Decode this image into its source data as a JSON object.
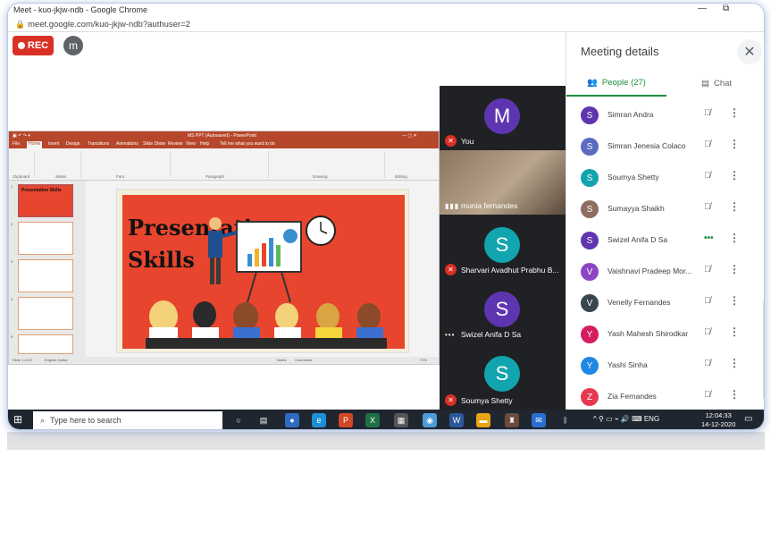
{
  "browser": {
    "title": "Meet - kuo-jkjw-ndb - Google Chrome",
    "url": "meet.google.com/kuo-jkjw-ndb?authuser=2"
  },
  "meet": {
    "rec_label": "REC",
    "self_initial": "m"
  },
  "presentation": {
    "window_title": "MS PPT (Autosaved) - PowerPoint",
    "tabs": [
      "File",
      "Home",
      "Insert",
      "Design",
      "Transitions",
      "Animations",
      "Slide Show",
      "Review",
      "View",
      "Help",
      "Tell me what you want to do"
    ],
    "ribbon_groups": [
      "Clipboard",
      "Slides",
      "Font",
      "Paragraph",
      "Drawing",
      "Editing"
    ],
    "slide_title_line1": "Presentation",
    "slide_title_line2": "Skills",
    "status_left": "Slide 1 of 22",
    "status_lang": "English (India)",
    "status_notes": "Notes",
    "status_comments": "Comments",
    "zoom": "72%",
    "thumb_numbers": [
      "1",
      "2",
      "3",
      "4",
      "5"
    ],
    "thumb_titles": [
      "Presentation Skills",
      "",
      "",
      "",
      ""
    ]
  },
  "tiles": [
    {
      "name": "You",
      "initial": "M",
      "color": "#5e35b1",
      "mic": "muted"
    },
    {
      "name": "munia fernandes",
      "initial": "",
      "color": "#7a6a58",
      "mic": "speaking"
    },
    {
      "name": "Sharvari Avadhut Prabhu B...",
      "initial": "S",
      "color": "#12a4af",
      "mic": "muted"
    },
    {
      "name": "Swizel Anifa D Sa",
      "initial": "S",
      "color": "#5e35b1",
      "mic": "dots"
    },
    {
      "name": "Soumya Shetty",
      "initial": "S",
      "color": "#12a4af",
      "mic": "muted"
    }
  ],
  "panel": {
    "title": "Meeting details",
    "tab_people": "People (27)",
    "tab_chat": "Chat",
    "people": [
      {
        "initial": "S",
        "name": "Simran Andra",
        "color": "#5e35b1",
        "status": "muted"
      },
      {
        "initial": "S",
        "name": "Simran Jenesia Colaco",
        "color": "#5c6bc0",
        "status": "muted"
      },
      {
        "initial": "S",
        "name": "Soumya Shetty",
        "color": "#12a4af",
        "status": "muted"
      },
      {
        "initial": "S",
        "name": "Sumayya Shaikh",
        "color": "#8d6e63",
        "status": "muted"
      },
      {
        "initial": "S",
        "name": "Swizel Anifa D Sa",
        "color": "#5e35b1",
        "status": "speaking"
      },
      {
        "initial": "V",
        "name": "Vaishnavi Pradeep Mor...",
        "color": "#8e44c4",
        "status": "muted"
      },
      {
        "initial": "V",
        "name": "Venelly Fernandes",
        "color": "#37474f",
        "status": "muted"
      },
      {
        "initial": "Y",
        "name": "Yash Mahesh Shirodkar",
        "color": "#d81b60",
        "status": "muted"
      },
      {
        "initial": "Y",
        "name": "Yashi Sinha",
        "color": "#1e88e5",
        "status": "muted"
      },
      {
        "initial": "Z",
        "name": "Zia Fernandes",
        "color": "#e53950",
        "status": "muted"
      }
    ]
  },
  "taskbar": {
    "search_placeholder": "Type here to search",
    "lang": "ENG",
    "time": "12:04:33",
    "date": "14-12-2020"
  }
}
